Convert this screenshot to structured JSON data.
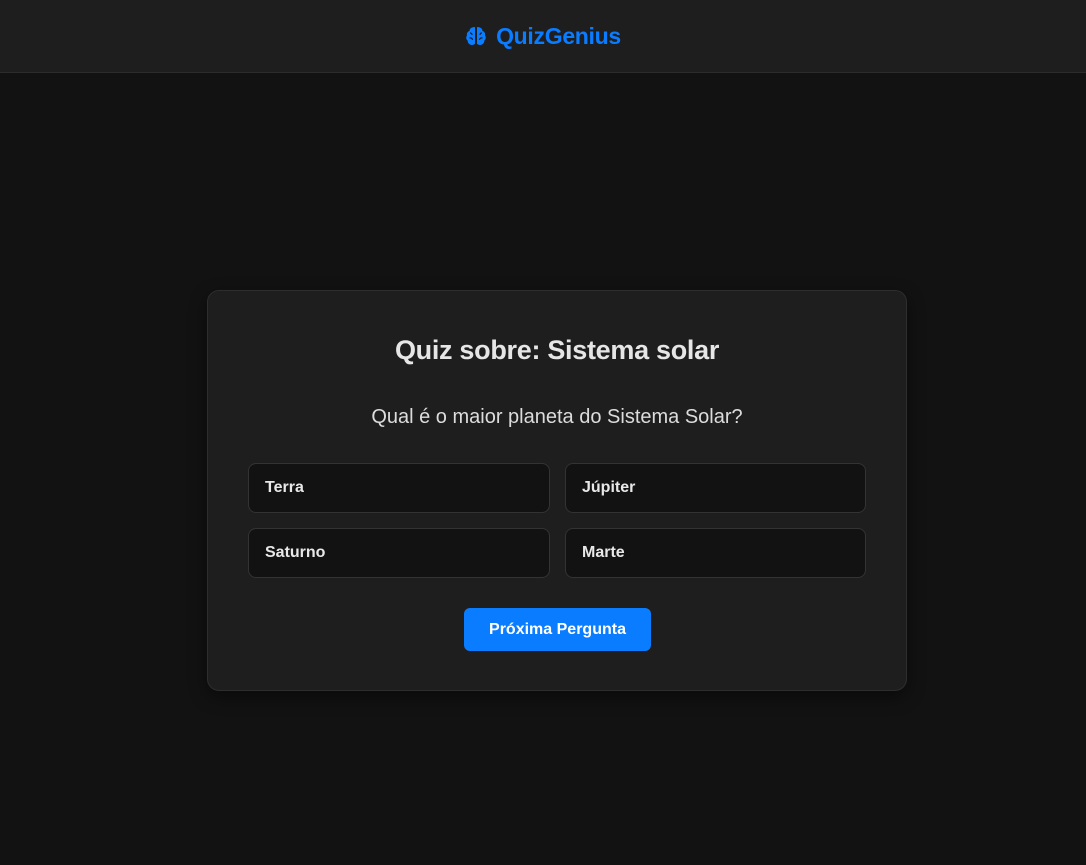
{
  "header": {
    "brand_name": "QuizGenius",
    "brand_icon": "brain-icon",
    "brand_color": "#0a7cff"
  },
  "quiz": {
    "title": "Quiz sobre: Sistema solar",
    "question": "Qual é o maior planeta do Sistema Solar?",
    "options": [
      {
        "label": "Terra"
      },
      {
        "label": "Júpiter"
      },
      {
        "label": "Saturno"
      },
      {
        "label": "Marte"
      }
    ],
    "next_button_label": "Próxima Pergunta"
  },
  "colors": {
    "background": "#121212",
    "surface": "#1e1e1e",
    "accent": "#0a7cff"
  }
}
